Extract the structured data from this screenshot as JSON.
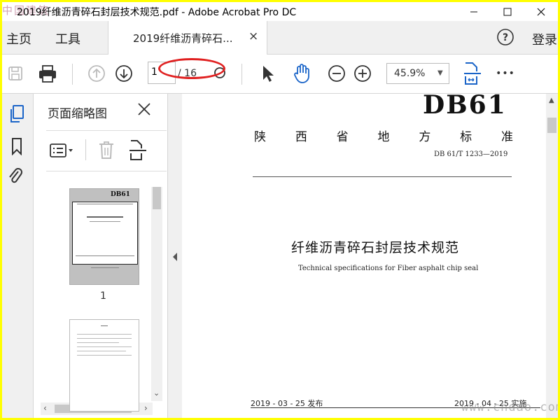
{
  "window": {
    "title": "2019纤维沥青碎石封层技术规范.pdf - Adobe Acrobat Pro DC",
    "watermark_top": "中国建筑"
  },
  "nav": {
    "home_label": "主页",
    "tools_label": "工具",
    "tab_label": "2019纤维沥青碎石...",
    "tab_close": "×",
    "login_label": "登录"
  },
  "toolbar": {
    "current_page": "1",
    "total_pages": "/ 16",
    "zoom": "45.9%",
    "more": "•••"
  },
  "thumbnails": {
    "panel_title": "页面缩略图",
    "page1_label": "1",
    "thumb_header": "DB61"
  },
  "document": {
    "code": "DB61",
    "standard_title_chars": [
      "陕",
      "西",
      "省",
      "地",
      "方",
      "标",
      "准"
    ],
    "standard_number": "DB 61/T  1233—2019",
    "title_cn": "纤维沥青碎石封层技术规范",
    "title_en": "Technical specifications for Fiber asphalt chip seal",
    "issue_date": "2019 - 03 - 25 发布",
    "implement_date": "2019 - 04 - 25 实施"
  },
  "watermark_bottom": "www.chdao.com",
  "colors": {
    "frame": "#ffff00",
    "accent_blue": "#1a64c8",
    "annotation_red": "#e02020"
  }
}
